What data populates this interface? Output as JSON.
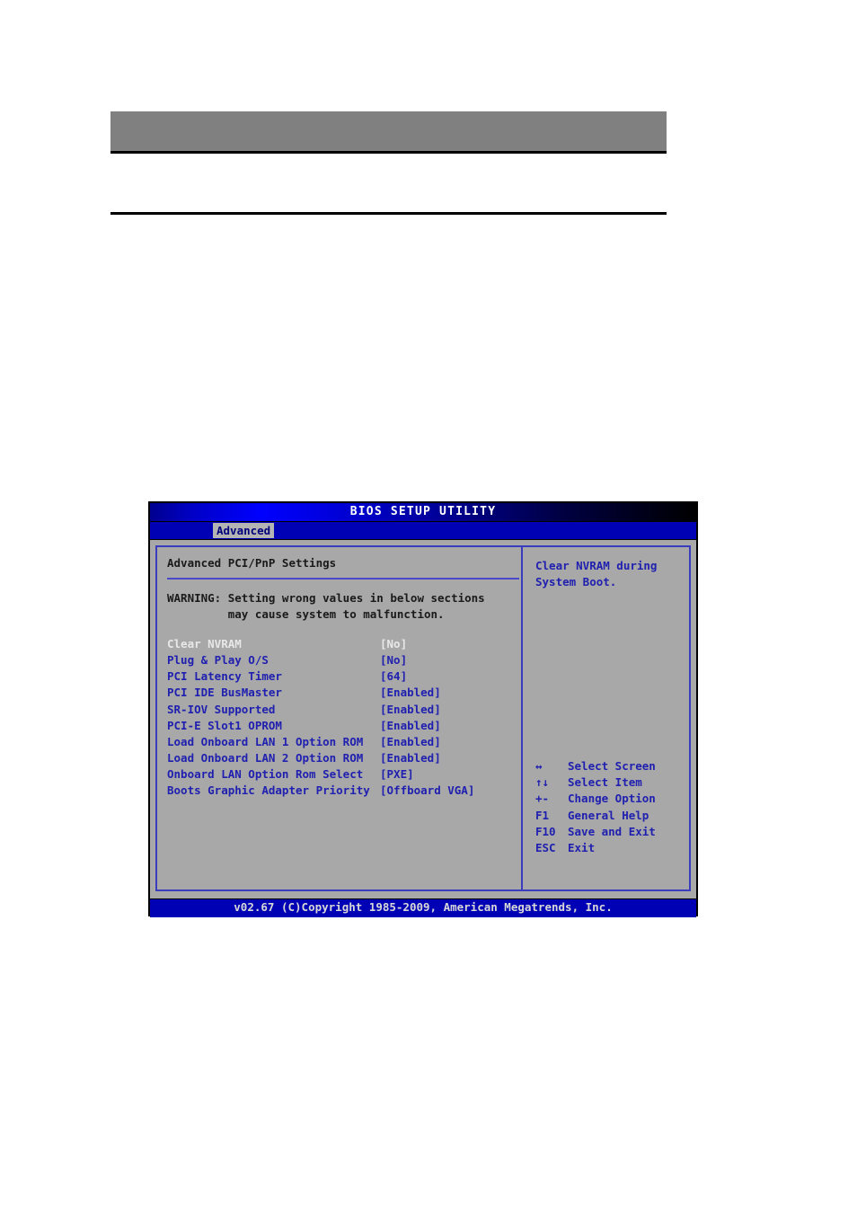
{
  "page": {
    "banner_text": "",
    "has_rule": true
  },
  "bios": {
    "title": "BIOS SETUP UTILITY",
    "active_tab": "Advanced",
    "section_title": "Advanced PCI/PnP Settings",
    "warning": "WARNING: Setting wrong values in below sections\n         may cause system to malfunction.",
    "settings": [
      {
        "label": "Clear NVRAM",
        "value": "[No]",
        "selected": true
      },
      {
        "label": "Plug & Play O/S",
        "value": "[No]",
        "selected": false
      },
      {
        "label": "PCI Latency Timer",
        "value": "[64]",
        "selected": false
      },
      {
        "label": "PCI IDE BusMaster",
        "value": "[Enabled]",
        "selected": false
      },
      {
        "label": "SR-IOV Supported",
        "value": "[Enabled]",
        "selected": false
      },
      {
        "label": "PCI-E Slot1 OPROM",
        "value": "[Enabled]",
        "selected": false
      },
      {
        "label": "Load Onboard LAN 1 Option ROM",
        "value": "[Enabled]",
        "selected": false
      },
      {
        "label": "Load Onboard LAN 2 Option ROM",
        "value": "[Enabled]",
        "selected": false
      },
      {
        "label": "Onboard LAN Option Rom Select",
        "value": "[PXE]",
        "selected": false
      },
      {
        "label": "Boots Graphic Adapter Priority",
        "value": "[Offboard VGA]",
        "selected": false
      }
    ],
    "help_text": "Clear NVRAM during\nSystem Boot.",
    "key_legend": [
      {
        "key": "↔",
        "desc": "Select Screen"
      },
      {
        "key": "↑↓",
        "desc": "Select Item"
      },
      {
        "key": "+-",
        "desc": "Change Option"
      },
      {
        "key": "F1",
        "desc": "General Help"
      },
      {
        "key": "F10",
        "desc": "Save and Exit"
      },
      {
        "key": "ESC",
        "desc": "Exit"
      }
    ],
    "footer": "v02.67 (C)Copyright 1985-2009, American Megatrends, Inc.",
    "colors": {
      "panel_bg": "#a8a8a8",
      "accent_blue": "#2020b0",
      "border_blue": "#3b3bbd",
      "bar_blue": "#0000b4",
      "selected_text": "#e8e8e8",
      "banner_gray": "#808080"
    }
  }
}
